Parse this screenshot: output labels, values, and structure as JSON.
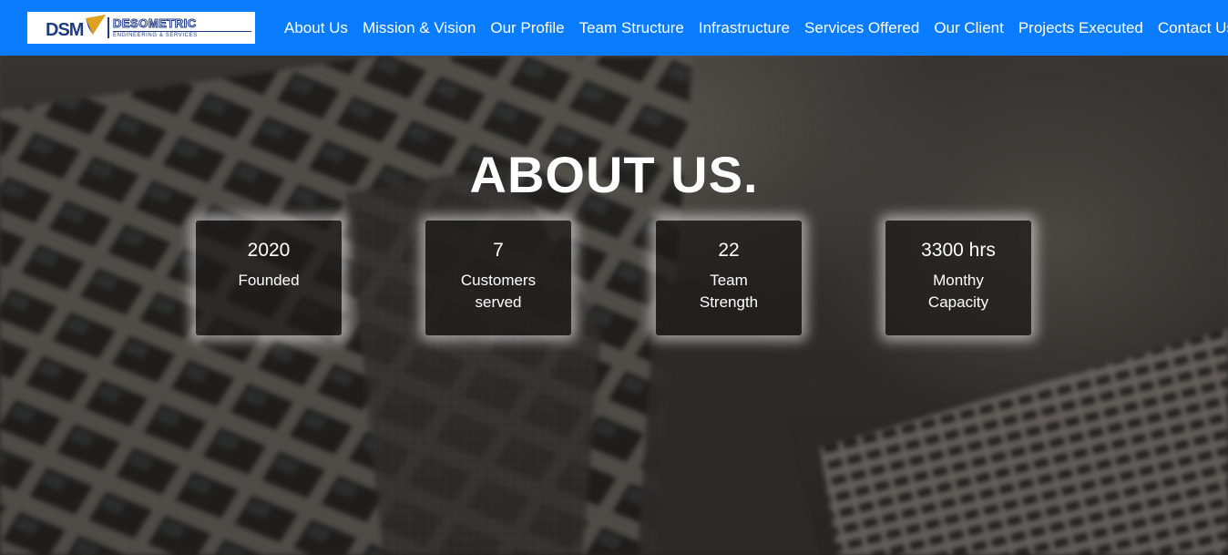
{
  "brand": {
    "name": "DESOMETRIC",
    "tagline": "ENGINEERING & SERVICES",
    "mark": "DSM"
  },
  "nav": {
    "items": [
      {
        "label": "About Us"
      },
      {
        "label": "Mission & Vision"
      },
      {
        "label": "Our Profile"
      },
      {
        "label": "Team Structure"
      },
      {
        "label": "Infrastructure"
      },
      {
        "label": "Services Offered"
      },
      {
        "label": "Our Client"
      },
      {
        "label": "Projects Executed"
      },
      {
        "label": "Contact Us"
      }
    ]
  },
  "hero": {
    "title": "ABOUT US.",
    "stats": [
      {
        "value": "2020",
        "label": "Founded"
      },
      {
        "value": "7",
        "label": "Customers served"
      },
      {
        "value": "22",
        "label": "Team Strength"
      },
      {
        "value": "3300 hrs",
        "label": "Monthy Capacity"
      }
    ]
  },
  "colors": {
    "navbar": "#0a7cff",
    "brand_blue": "#1f3b86",
    "brand_gold": "#e0a020"
  }
}
